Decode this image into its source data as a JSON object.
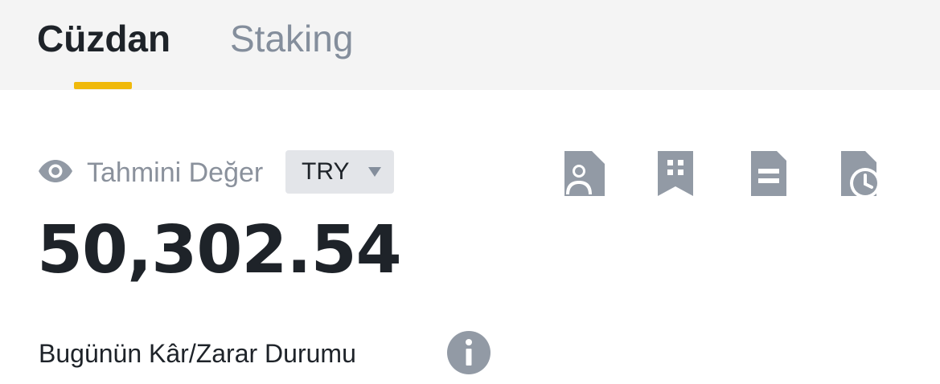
{
  "tabs": {
    "active_label": "Cüzdan",
    "inactive_label": "Staking"
  },
  "summary": {
    "estimated_label": "Tahmini Değer",
    "currency": "TRY",
    "balance": "50,302.54"
  },
  "pnl": {
    "label": "Bugünün Kâr/Zarar Durumu"
  },
  "icons": {
    "visibility": "eye-icon",
    "currency_caret": "caret-down-icon",
    "actions": [
      "account-document-icon",
      "building-bookmark-icon",
      "document-icon",
      "history-document-icon"
    ],
    "info": "info-icon"
  },
  "colors": {
    "accent": "#f0b90b",
    "text_primary": "#1e2329",
    "text_secondary": "#848e9c",
    "icon_gray": "#929aa5",
    "tabbar_bg": "#f4f4f4",
    "select_bg": "#e3e5e9"
  }
}
